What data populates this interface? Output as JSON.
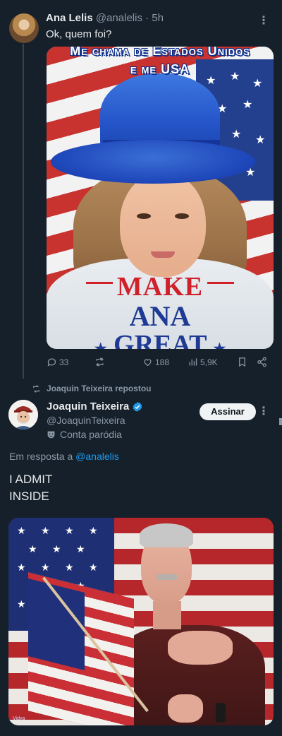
{
  "tweet1": {
    "author_name": "Ana Lelis",
    "author_handle": "@analelis",
    "time": "· 5h",
    "text": "Ok, quem foi?",
    "media": {
      "caption_line1": "Me chama de Estados Unidos",
      "caption_line2": "e me USA",
      "make": "MAKE",
      "ana": "ANA",
      "great": "GREAT"
    },
    "actions": {
      "replies": "33",
      "retweets": "",
      "likes": "188",
      "views": "5,9K"
    }
  },
  "repost_header": "Joaquin Teixeira repostou",
  "tweet2": {
    "author_name": "Joaquin Teixeira",
    "author_handle": "@JoaquinTeixeira",
    "parody_label": "Conta paródia",
    "follow_label": "Assinar",
    "reply_prefix": "Em resposta a",
    "reply_handle": "@analelis",
    "text_line1": "I ADMIT",
    "text_line2": "INSIDE",
    "media_watermark": "Vidya"
  },
  "colors": {
    "background": "#15202b",
    "text_primary": "#e7e9ea",
    "text_secondary": "#8b98a5",
    "link": "#1d9bf0",
    "verified": "#1d9bf0"
  },
  "icons": [
    "reply-icon",
    "retweet-icon",
    "like-icon",
    "views-icon",
    "bookmark-icon",
    "share-icon",
    "verified-icon",
    "parody-mask-icon",
    "more-icon"
  ]
}
